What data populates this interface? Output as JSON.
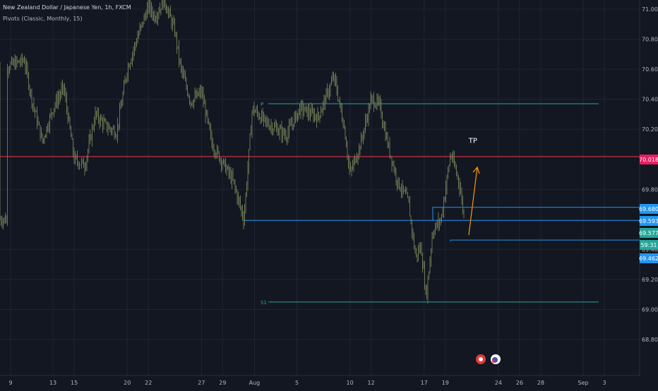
{
  "header": {
    "symbol_title": "New Zealand Dollar / Japanese Yen, 1h, FXCM",
    "indicator_title": "Pivots (Classic, Monthly, 15)"
  },
  "chart_data": {
    "type": "candlestick",
    "symbol": "New Zealand Dollar / Japanese Yen",
    "interval": "1h",
    "source": "FXCM",
    "ylim": [
      68.7,
      71.1
    ],
    "y_ticks": [
      "71.000",
      "70.800",
      "70.600",
      "70.400",
      "70.200",
      "69.800",
      "69.400",
      "69.200",
      "69.000",
      "68.800"
    ],
    "x_ticks": [
      "9",
      "13",
      "15",
      "20",
      "22",
      "27",
      "29",
      "Aug",
      "5",
      "10",
      "12",
      "17",
      "19",
      "24",
      "26",
      "28",
      "Sep",
      "3"
    ],
    "x_tick_days": [
      9,
      13,
      15,
      20,
      22,
      27,
      29,
      32,
      36,
      41,
      43,
      48,
      50,
      55,
      57,
      59,
      63,
      65
    ],
    "x_day_range": [
      8.7,
      65.8
    ],
    "price_path": [
      {
        "day": 8.7,
        "price": 70.62
      },
      {
        "day": 10.3,
        "price": 70.66
      },
      {
        "day": 11.0,
        "price": 70.4
      },
      {
        "day": 12.0,
        "price": 70.12
      },
      {
        "day": 13.0,
        "price": 70.34
      },
      {
        "day": 14.0,
        "price": 70.48
      },
      {
        "day": 15.0,
        "price": 70.0
      },
      {
        "day": 16.0,
        "price": 69.96
      },
      {
        "day": 17.0,
        "price": 70.3
      },
      {
        "day": 18.0,
        "price": 70.22
      },
      {
        "day": 19.0,
        "price": 70.18
      },
      {
        "day": 20.0,
        "price": 70.6
      },
      {
        "day": 21.0,
        "price": 70.82
      },
      {
        "day": 22.0,
        "price": 71.02
      },
      {
        "day": 22.6,
        "price": 70.95
      },
      {
        "day": 23.5,
        "price": 71.06
      },
      {
        "day": 24.5,
        "price": 70.85
      },
      {
        "day": 25.0,
        "price": 70.62
      },
      {
        "day": 26.0,
        "price": 70.38
      },
      {
        "day": 27.0,
        "price": 70.45
      },
      {
        "day": 28.0,
        "price": 70.1
      },
      {
        "day": 29.0,
        "price": 69.98
      },
      {
        "day": 30.0,
        "price": 69.85
      },
      {
        "day": 31.0,
        "price": 69.6
      },
      {
        "day": 31.8,
        "price": 70.34
      },
      {
        "day": 33.0,
        "price": 70.25
      },
      {
        "day": 35.0,
        "price": 70.16
      },
      {
        "day": 36.3,
        "price": 70.34
      },
      {
        "day": 38.0,
        "price": 70.28
      },
      {
        "day": 39.5,
        "price": 70.55
      },
      {
        "day": 40.5,
        "price": 70.2
      },
      {
        "day": 41.0,
        "price": 69.9
      },
      {
        "day": 42.0,
        "price": 70.1
      },
      {
        "day": 43.0,
        "price": 70.4
      },
      {
        "day": 43.8,
        "price": 70.36
      },
      {
        "day": 44.5,
        "price": 70.12
      },
      {
        "day": 45.5,
        "price": 69.85
      },
      {
        "day": 46.5,
        "price": 69.72
      },
      {
        "day": 47.2,
        "price": 69.35
      },
      {
        "day": 47.7,
        "price": 69.42
      },
      {
        "day": 48.2,
        "price": 69.08
      },
      {
        "day": 48.8,
        "price": 69.52
      },
      {
        "day": 49.6,
        "price": 69.6
      },
      {
        "day": 50.5,
        "price": 70.04
      },
      {
        "day": 51.3,
        "price": 69.85
      },
      {
        "day": 51.8,
        "price": 69.6
      }
    ],
    "horizontal_levels": [
      {
        "label": "P",
        "price": 70.37,
        "color": "#26a69a"
      },
      {
        "label": "S1",
        "price": 69.05,
        "color": "#26a69a"
      },
      {
        "label": "",
        "price": 70.018,
        "color": "#f23645"
      },
      {
        "label": "",
        "price": 69.593,
        "color": "#2196f3"
      },
      {
        "label": "",
        "price": 69.68,
        "color": "#2196f3"
      },
      {
        "label": "",
        "price": 69.462,
        "color": "#2196f3"
      }
    ],
    "annotations": [
      {
        "text": "TP",
        "day": 52.6,
        "price": 70.11
      }
    ],
    "price_labels": [
      {
        "text": "70.018",
        "price": 70.018,
        "color": "#e91e63"
      },
      {
        "text": "69.680",
        "price": 69.68,
        "color": "#2196f3"
      },
      {
        "text": "69.593",
        "price": 69.593,
        "color": "#2196f3"
      },
      {
        "text": "69.577",
        "price": 69.577,
        "color": "#26a69a"
      },
      {
        "text": "59:31",
        "price": 69.515,
        "color": "#26a69a"
      },
      {
        "text": "69.462",
        "price": 69.462,
        "color": "#2196f3"
      }
    ],
    "grid": true,
    "colors": {
      "background": "#131722",
      "candles": "#6b7552",
      "grid": "#1f2535",
      "axis_text": "#b2b5be"
    }
  }
}
